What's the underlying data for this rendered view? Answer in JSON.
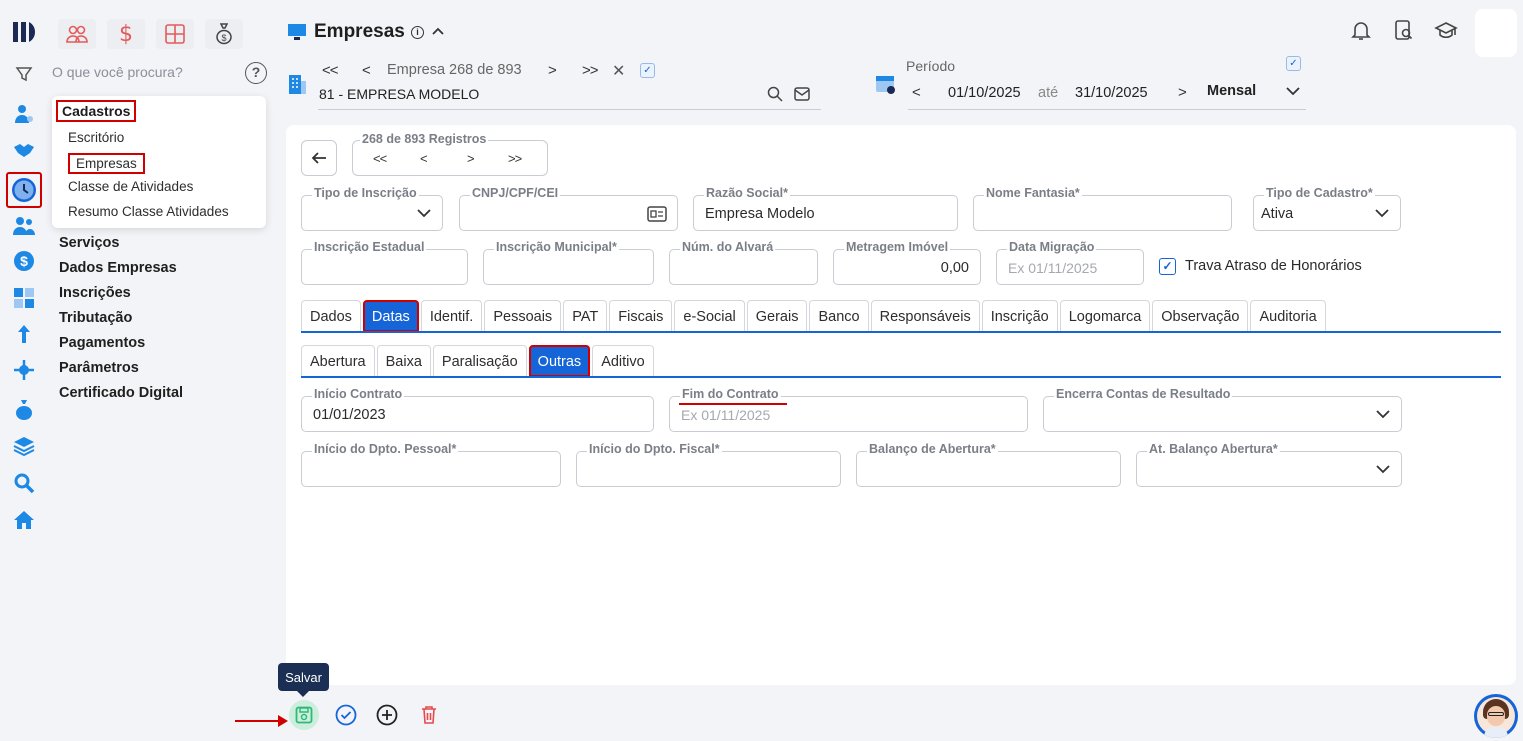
{
  "search": {
    "placeholder": "O que você procura?"
  },
  "menu_popup": {
    "header": "Cadastros",
    "items": [
      "Escritório",
      "Empresas",
      "Classe de Atividades",
      "Resumo Classe Atividades"
    ]
  },
  "nav": [
    "Serviços",
    "Dados Empresas",
    "Inscrições",
    "Tributação",
    "Pagamentos",
    "Parâmetros",
    "Certificado Digital"
  ],
  "header": {
    "title": "Empresas",
    "company_nav_text": "Empresa 268 de 893",
    "company_name": "81 - EMPRESA MODELO",
    "period_label": "Período",
    "date_from": "01/10/2025",
    "date_sep": "até",
    "date_to": "31/10/2025",
    "period_type": "Mensal"
  },
  "records": {
    "label": "268 de 893 Registros"
  },
  "form": {
    "tipo_inscricao": {
      "label": "Tipo de Inscrição",
      "value": ""
    },
    "cnpj": {
      "label": "CNPJ/CPF/CEI",
      "value": ""
    },
    "razao_social": {
      "label": "Razão Social*",
      "value": "Empresa Modelo"
    },
    "nome_fantasia": {
      "label": "Nome Fantasia*",
      "value": ""
    },
    "tipo_cadastro": {
      "label": "Tipo de Cadastro*",
      "value": "Ativa"
    },
    "insc_estadual": {
      "label": "Inscrição Estadual",
      "value": ""
    },
    "insc_municipal": {
      "label": "Inscrição Municipal*",
      "value": ""
    },
    "num_alvara": {
      "label": "Núm. do Alvará",
      "value": ""
    },
    "metragem": {
      "label": "Metragem Imóvel",
      "value": "0,00"
    },
    "data_migracao": {
      "label": "Data Migração",
      "placeholder": "Ex 01/11/2025"
    },
    "trava": {
      "label": "Trava Atraso de Honorários",
      "checked": true
    }
  },
  "tabs": [
    "Dados",
    "Datas",
    "Identif.",
    "Pessoais",
    "PAT",
    "Fiscais",
    "e-Social",
    "Gerais",
    "Banco",
    "Responsáveis",
    "Inscrição",
    "Logomarca",
    "Observação",
    "Auditoria"
  ],
  "subtabs": [
    "Abertura",
    "Baixa",
    "Paralisação",
    "Outras",
    "Aditivo"
  ],
  "outras": {
    "inicio_contrato": {
      "label": "Início Contrato",
      "value": "01/01/2023"
    },
    "fim_contrato": {
      "label": "Fim do Contrato",
      "placeholder": "Ex 01/11/2025"
    },
    "encerra": {
      "label": "Encerra Contas de Resultado",
      "value": ""
    },
    "inicio_pessoal": {
      "label": "Início do Dpto. Pessoal*",
      "value": ""
    },
    "inicio_fiscal": {
      "label": "Início do Dpto. Fiscal*",
      "value": ""
    },
    "balanco": {
      "label": "Balanço de Abertura*",
      "value": ""
    },
    "at_balanco": {
      "label": "At. Balanço Abertura*",
      "value": ""
    }
  },
  "tooltip": {
    "save": "Salvar"
  },
  "colors": {
    "accent": "#1565d8",
    "highlight": "#d10000",
    "save": "#2fb87a",
    "delete": "#e64a4a"
  }
}
